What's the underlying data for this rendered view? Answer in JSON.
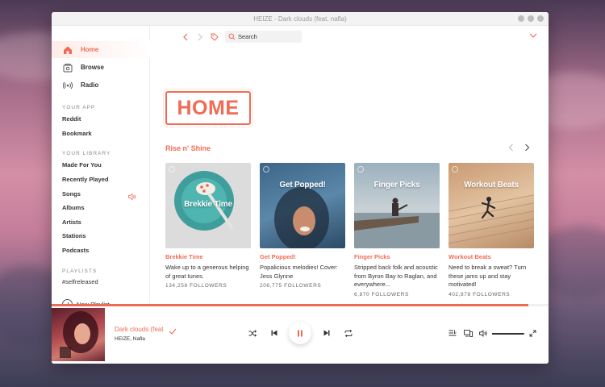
{
  "window": {
    "title": "HEIZE - Dark clouds (feat. nafla)"
  },
  "sidebar": {
    "nav": [
      {
        "label": "Home",
        "icon": "home-icon",
        "active": true
      },
      {
        "label": "Browse",
        "icon": "browse-icon",
        "active": false
      },
      {
        "label": "Radio",
        "icon": "radio-icon",
        "active": false
      }
    ],
    "your_app_heading": "YOUR APP",
    "your_app": [
      "Reddit",
      "Bookmark"
    ],
    "your_library_heading": "YOUR LIBRARY",
    "your_library": [
      "Made For You",
      "Recently Played",
      "Songs",
      "Albums",
      "Artists",
      "Stations",
      "Podcasts"
    ],
    "playlists_heading": "PLAYLISTS",
    "playlists": [
      "#selfreleased"
    ],
    "new_playlist_label": "New Playlist"
  },
  "toolbar": {
    "search_placeholder": "Search"
  },
  "main": {
    "heading": "HOME",
    "section_title": "Rise n' Shine",
    "cards": [
      {
        "cover_text": "Brekkie Time",
        "name": "Brekkie Time",
        "description": "Wake up to a generous helping of great tunes.",
        "followers": "134,258 FOLLOWERS",
        "color": "#dcdcdc"
      },
      {
        "cover_text": "Get Popped!",
        "name": "Get Popped!",
        "description": "Popalicious melodies! Cover: Jess Glynne",
        "followers": "206,775 FOLLOWERS",
        "color": "#5b7d9e"
      },
      {
        "cover_text": "Finger Picks",
        "name": "Finger Picks",
        "description": "Stripped back folk and acoustic from Byron Bay to Raglan, and everywhere...",
        "followers": "6,870 FOLLOWERS",
        "color": "#8fa5b2"
      },
      {
        "cover_text": "Workout Beats",
        "name": "Workout Beats",
        "description": "Need to break a sweat? Turn these jams up and stay motivated!",
        "followers": "402,878 FOLLOWERS",
        "color": "#d8a77c"
      }
    ]
  },
  "player": {
    "track_title": "Dark clouds (feat",
    "track_artist": "HEIZE, Nafla",
    "progress": 1.0,
    "volume": 0.85,
    "accent": "#f06b55"
  }
}
